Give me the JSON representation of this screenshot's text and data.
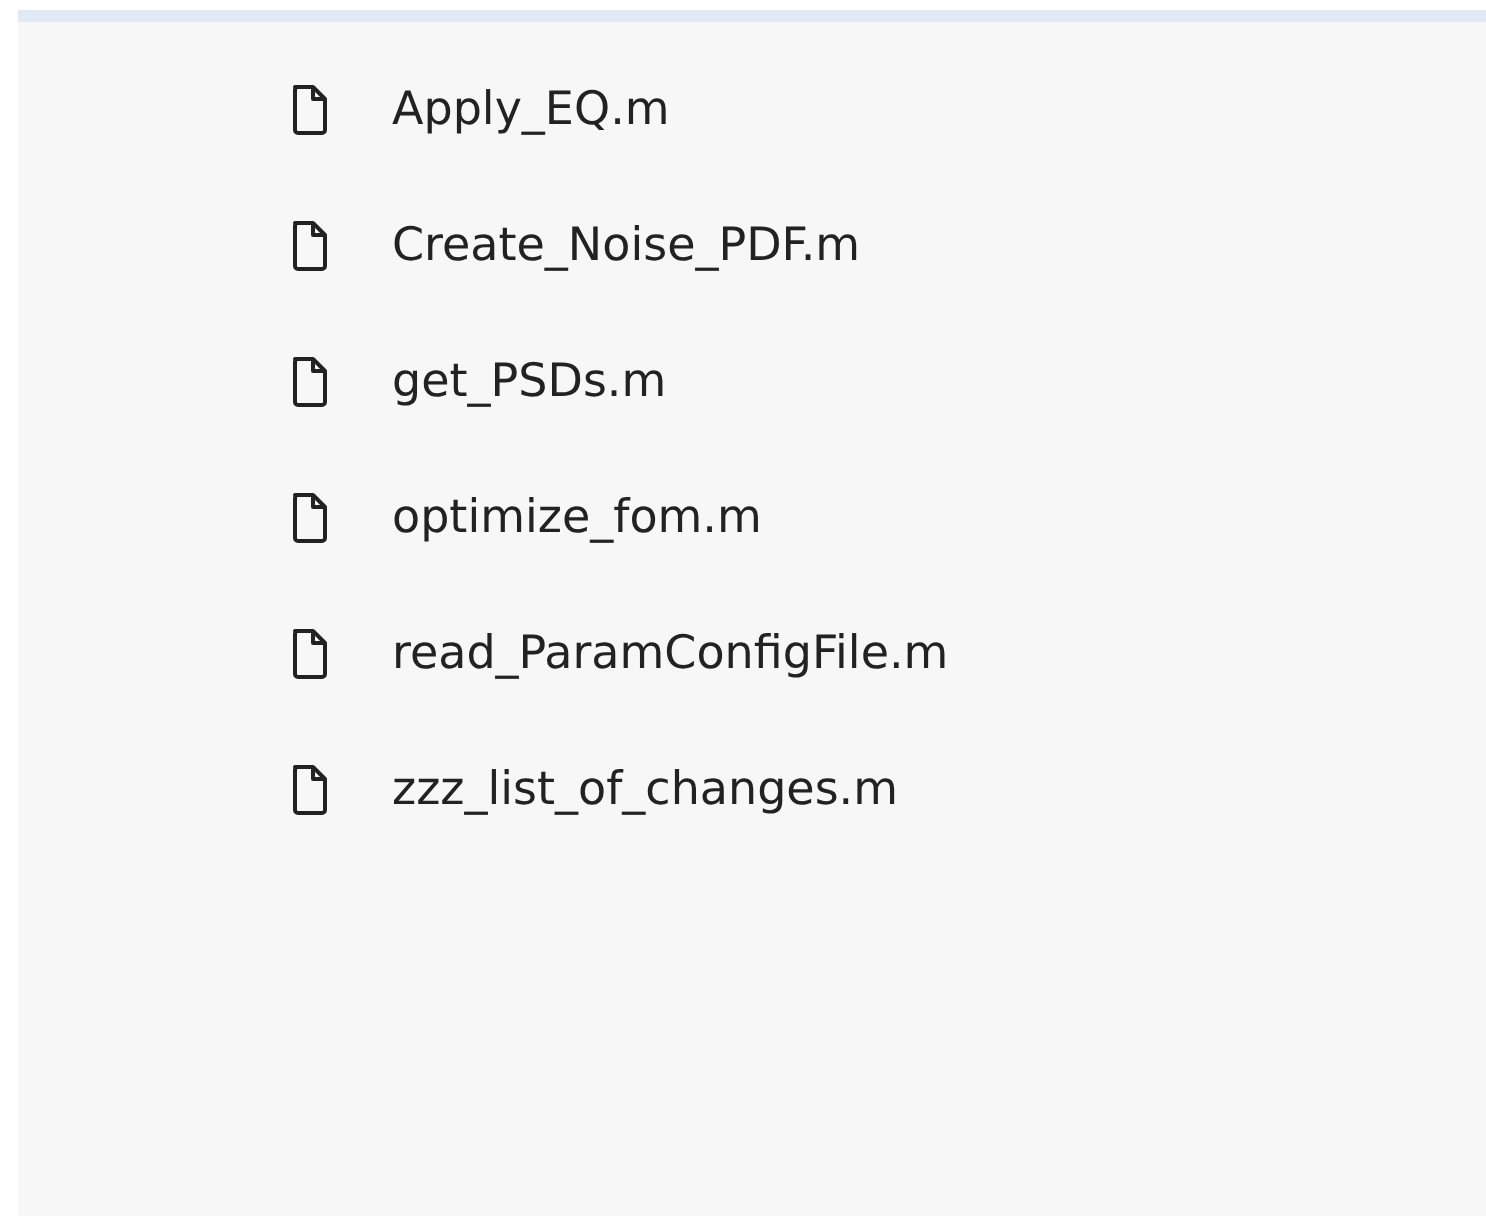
{
  "files": [
    {
      "name": "Apply_EQ.m"
    },
    {
      "name": "Create_Noise_PDF.m"
    },
    {
      "name": "get_PSDs.m"
    },
    {
      "name": "optimize_fom.m"
    },
    {
      "name": "read_ParamConfigFile.m"
    },
    {
      "name": "zzz_list_of_changes.m"
    }
  ]
}
